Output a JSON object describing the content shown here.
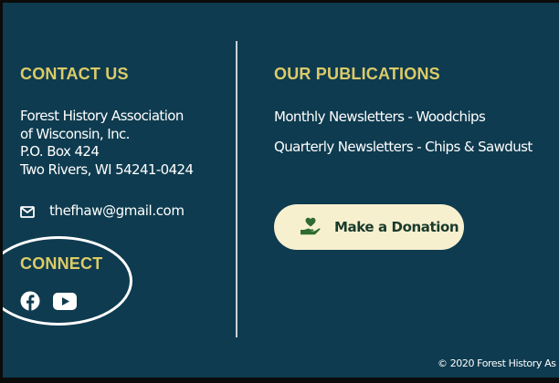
{
  "contact": {
    "heading": "CONTACT US",
    "address_lines": [
      "Forest History Association",
      "of Wisconsin, Inc.",
      "P.O. Box 424",
      "Two Rivers, WI 54241-0424"
    ],
    "email": "thefhaw@gmail.com",
    "email_icon": "envelope-icon"
  },
  "connect": {
    "heading": "CONNECT",
    "icons": [
      "facebook-icon",
      "youtube-icon"
    ]
  },
  "publications": {
    "heading": "OUR PUBLICATIONS",
    "links": [
      "Monthly Newsletters - Woodchips",
      "Quarterly Newsletters - Chips & Sawdust"
    ]
  },
  "donate": {
    "label": "Make a Donation",
    "icon": "hand-heart-icon"
  },
  "footer": {
    "copyright": "© 2020 Forest History As"
  },
  "colors": {
    "background": "#0e3b4f",
    "heading": "#dccb68",
    "button_bg": "#f7f0cf",
    "button_text": "#1a3b2c"
  }
}
